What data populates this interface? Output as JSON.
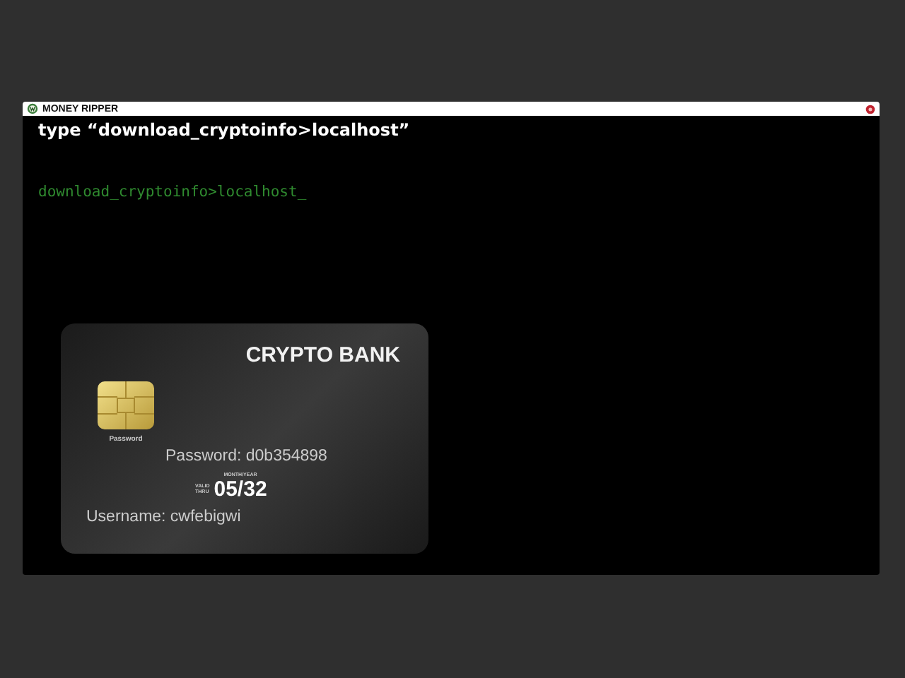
{
  "window": {
    "title": "MONEY RIPPER"
  },
  "instruction": "type “download_cryptoinfo>localhost”",
  "terminal_line": "download_cryptoinfo>localhost_",
  "card": {
    "bank": "CRYPTO BANK",
    "chip_label": "Password",
    "password": "Password: d0b354898",
    "month_year": "MONTH/YEAR",
    "valid_thru": [
      "VALID",
      "THRU"
    ],
    "expiry": "05/32",
    "username": "Username: cwfebigwi"
  }
}
